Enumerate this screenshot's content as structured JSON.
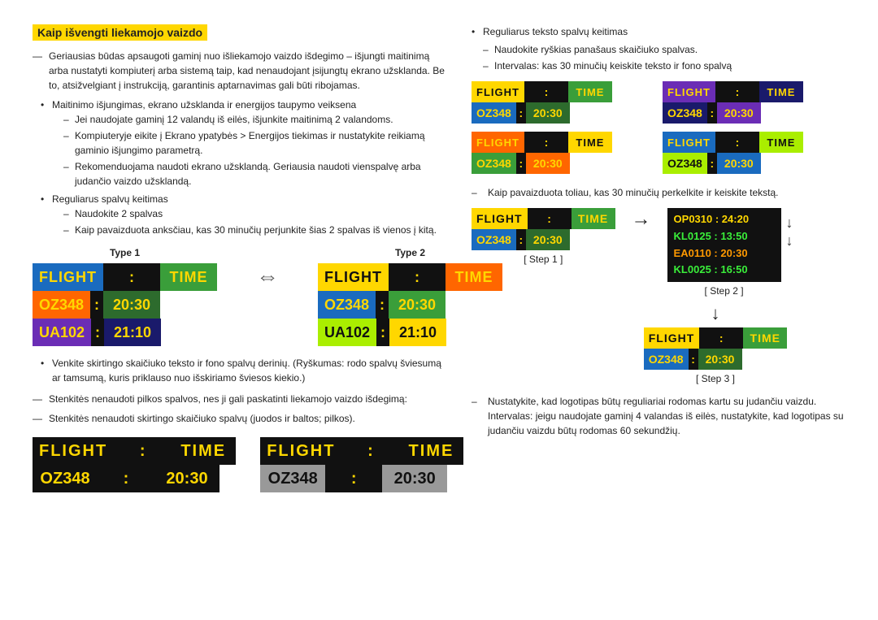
{
  "title": "Kaip išvengti liekamojo vaizdo",
  "left": {
    "section_title": "Kaip išvengti liekamojo vaizdo",
    "intro_dash": "Geriausias būdas apsaugoti gaminį nuo išliekamojo vaizdo išdegimo – išjungti maitinimą arba nustatyti kompiuterį arba sistemą taip, kad nenaudojant įsijungtų ekrano užsklanda. Be to, atsižvelgiant į instrukciją, garantinis aptarnavimas gali būti ribojamas.",
    "bullets": [
      {
        "text": "Maitinimo išjungimas, ekrano užsklanda ir energijos taupymo veiksena",
        "sub": [
          "Jei naudojate gaminį 12 valandų iš eilės, išjunkite maitinimą 2 valandoms.",
          "Kompiuteryje eikite į Ekrano ypatybės > Energijos tiekimas ir nustatykite reikiamą gaminio išjungimo parametrą.",
          "Rekomenduojama naudoti ekrano užsklandą. Geriausia naudoti vienspalvę arba judančio vaizdo užsklandą."
        ]
      },
      {
        "text": "Reguliarus spalvų keitimas",
        "sub": [
          "Naudokite 2 spalvas",
          "Kaip pavaizduota anksčiau, kas 30 minučių perjunkite šias 2 spalvas iš vienos į kitą."
        ]
      }
    ],
    "type1_label": "Type 1",
    "type2_label": "Type 2",
    "bottom_bullets": [
      "Venkite skirtingo skaičiuko teksto ir fono spalvų derinių. (Ryškumas: rodo spalvų šviesumą ar tamsumą, kuris priklauso nuo išskiriamo šviesos kiekio.)"
    ],
    "bottom_dashes": [
      "Stenkitės nenaudoti pilkos spalvos, nes ji gali paskatinti liekamojo vaizdo išdegimą:",
      "Stenkitės nenaudoti skirtingo skaičiuko spalvų (juodos ir baltos; pilkos)."
    ],
    "flight_label": "FLIGHT",
    "time_label": "TIME",
    "colon": ":",
    "oz348": "OZ348",
    "t2030": "20:30",
    "ua102": "UA102",
    "t2110": "21:10"
  },
  "right": {
    "bullet1": "Reguliarus teksto spalvų keitimas",
    "sub1": "Naudokite ryškias panašaus skaičiuko spalvas.",
    "sub2": "Intervalas: kas 30 minučių keiskite teksto ir fono spalvą",
    "dash1": "Kaip pavaizduota toliau, kas 30 minučių perkelkite ir keiskite tekstą.",
    "step1_label": "[ Step 1 ]",
    "step2_label": "[ Step 2 ]",
    "step3_label": "[ Step 3 ]",
    "scrolling": [
      "OP0310 : 24:20",
      "KL0125 : 13:50",
      "EA0110 : 20:30",
      "KL0025 : 16:50"
    ],
    "dash_final": "Nustatykite, kad logotipas būtų reguliariai rodomas kartu su judančiu vaizdu. Intervalas: jeigu naudojate gaminį 4 valandas iš eilės, nustatykite, kad logotipas su judančiu vaizdu būtų rodomas 60 sekundžių.",
    "flight_label": "FLIGHT",
    "time_label": "TIME",
    "colon": ":",
    "oz348": "OZ348",
    "t2030": "20:30"
  }
}
